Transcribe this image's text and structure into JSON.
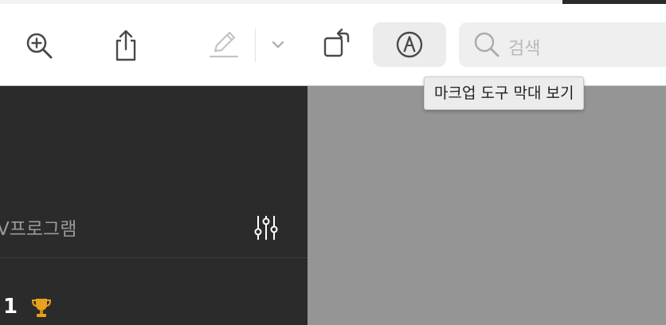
{
  "toolbar": {
    "zoom_in_icon": "magnifier-plus-icon",
    "share_icon": "share-icon",
    "highlight_icon": "pen-icon",
    "chevron_icon": "chevron-down-icon",
    "rotate_icon": "rotate-icon",
    "markup_icon": "markup-icon",
    "search_placeholder": "검색",
    "tooltip": "마크업 도구 막대 보기"
  },
  "sidebar": {
    "heading": "V프로그램",
    "filter_icon": "sliders-icon",
    "rank": "1",
    "trophy_icon": "trophy-icon"
  },
  "colors": {
    "toolbar_bg": "#ffffff",
    "sidebar_bg": "#2b2b2b",
    "content_bg": "#959595",
    "trophy": "#e8a21a"
  }
}
